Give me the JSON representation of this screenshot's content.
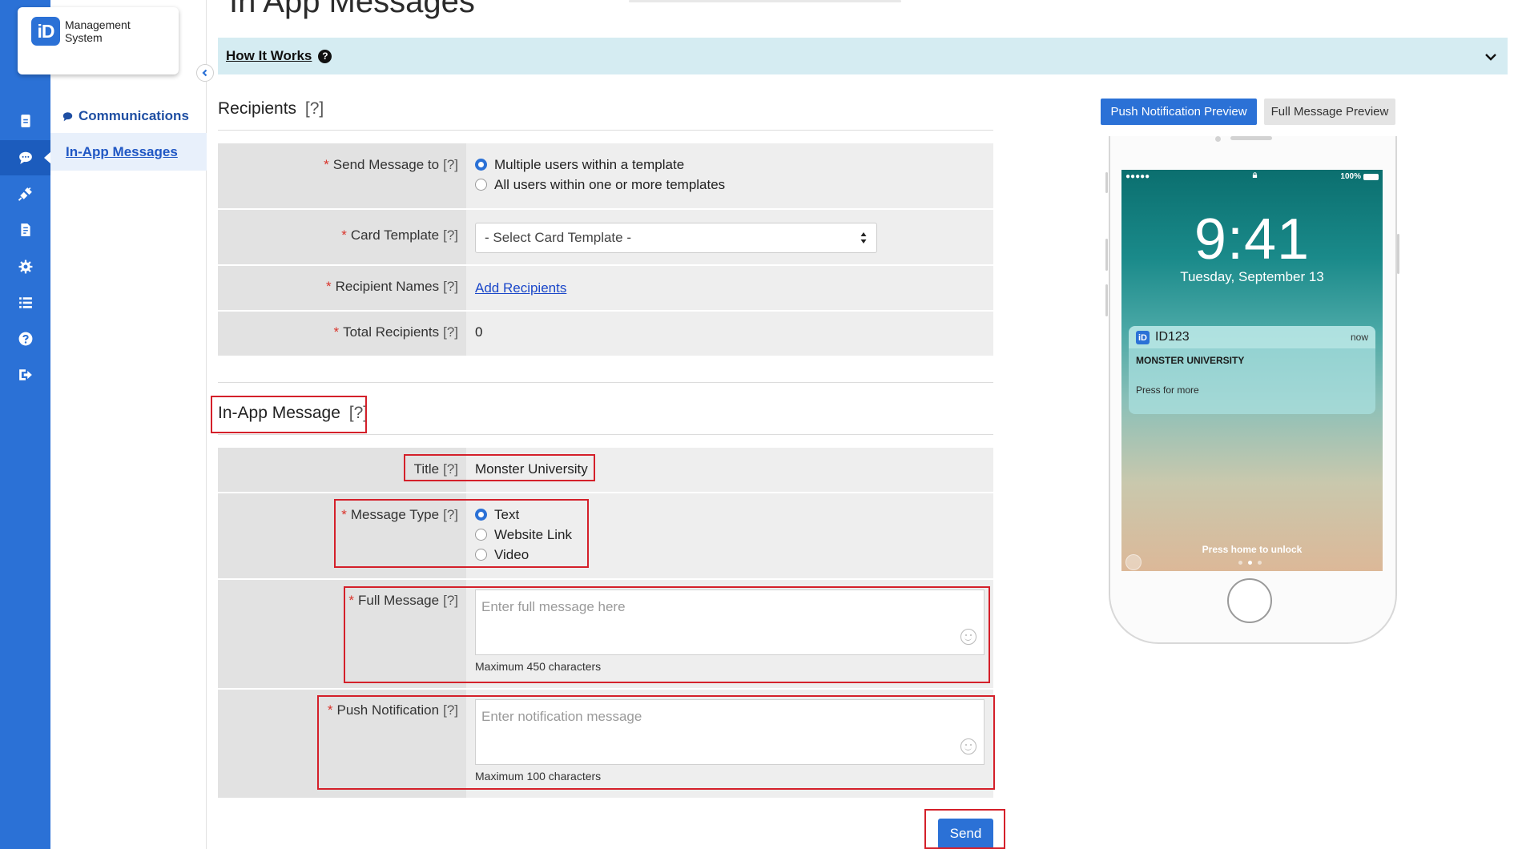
{
  "app": {
    "logo_mark": "iD",
    "logo_line1": "Management",
    "logo_line2": "System"
  },
  "rail": {
    "icons": [
      "id-card-icon",
      "chat-icon",
      "plug-icon",
      "document-icon",
      "gear-icon",
      "list-icon",
      "help-icon",
      "sign-out-icon"
    ],
    "active_index": 1,
    "accent": "#2b71d6"
  },
  "subnav": {
    "section_label": "Communications",
    "active_item": "In-App Messages"
  },
  "page": {
    "title": "In App Messages"
  },
  "how_it_works": {
    "label": "How It Works",
    "icon": "?"
  },
  "recipients": {
    "heading": "Recipients",
    "help": "[?]",
    "send_to": {
      "label": "Send Message to",
      "help": "[?]",
      "options": [
        "Multiple users within a template",
        "All users within one or more templates"
      ],
      "selected": 0
    },
    "card_template": {
      "label": "Card Template",
      "help": "[?]",
      "value": "- Select Card Template -"
    },
    "recipient_names": {
      "label": "Recipient Names",
      "help": "[?]",
      "link": "Add Recipients"
    },
    "total_recipients": {
      "label": "Total Recipients",
      "help": "[?]",
      "value": "0"
    }
  },
  "message": {
    "heading": "In-App Message",
    "help": "[?]",
    "title": {
      "label": "Title",
      "help": "[?]",
      "value": "Monster University"
    },
    "type": {
      "label": "Message Type",
      "help": "[?]",
      "options": [
        "Text",
        "Website Link",
        "Video"
      ],
      "selected": 0
    },
    "full_message": {
      "label": "Full Message",
      "help": "[?]",
      "placeholder": "Enter full message here",
      "hint": "Maximum 450 characters"
    },
    "push": {
      "label": "Push Notification",
      "help": "[?]",
      "placeholder": "Enter notification message",
      "hint": "Maximum 100 characters"
    },
    "required_mark": "*"
  },
  "send_label": "Send",
  "preview": {
    "tab_push": "Push Notification Preview",
    "tab_full": "Full Message Preview",
    "status_left": "●●●●● ",
    "status_battery": "100%",
    "time": "9:41",
    "date": "Tuesday, September 13",
    "notif_app": "ID123",
    "notif_time": "now",
    "notif_title": "MONSTER UNIVERSITY",
    "notif_body": "Press for more",
    "unlock_text": "Press home to unlock"
  }
}
